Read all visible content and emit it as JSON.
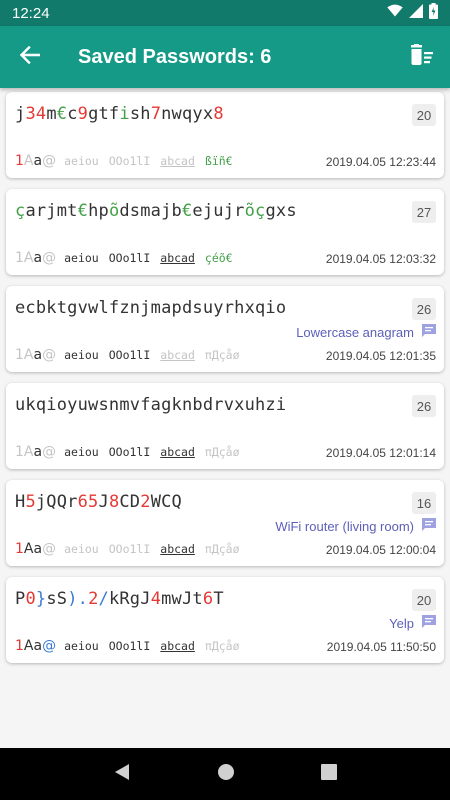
{
  "status_bar": {
    "time": "12:24",
    "icons": [
      "wifi-icon",
      "signal-icon",
      "battery-icon"
    ]
  },
  "app_bar": {
    "title": "Saved Passwords: 6"
  },
  "colors": {
    "status_bar": "#117a6b",
    "app_bar": "#159a88",
    "red": "#e53935",
    "green": "#43a047",
    "note": "#5c5fb8"
  },
  "passwords": [
    {
      "segments": [
        {
          "t": "j",
          "c": "dark"
        },
        {
          "t": "34",
          "c": "red"
        },
        {
          "t": "m",
          "c": "dark"
        },
        {
          "t": "€",
          "c": "green"
        },
        {
          "t": "c",
          "c": "dark"
        },
        {
          "t": "9",
          "c": "red"
        },
        {
          "t": "gtf",
          "c": "dark"
        },
        {
          "t": "i",
          "c": "green"
        },
        {
          "t": "sh",
          "c": "dark"
        },
        {
          "t": "7",
          "c": "red"
        },
        {
          "t": "nwqyx",
          "c": "dark"
        },
        {
          "t": "8",
          "c": "red"
        }
      ],
      "length": "20",
      "note": "",
      "date": "2019.04.05 12:23:44",
      "features": {
        "case": [
          {
            "t": "1",
            "c": "red"
          },
          {
            "t": "A",
            "c": "faint"
          },
          {
            "t": "a",
            "c": "dark"
          },
          {
            "t": "@",
            "c": "faint"
          }
        ],
        "vowels": {
          "t": "aeiou",
          "c": "faint"
        },
        "similar": {
          "t": "OOo1lI",
          "c": "faint"
        },
        "sequence": {
          "t": "abcad",
          "c": "faint"
        },
        "special": {
          "t": "ßïñ€",
          "c": "green"
        }
      }
    },
    {
      "segments": [
        {
          "t": "ç",
          "c": "green"
        },
        {
          "t": "arjmt",
          "c": "dark"
        },
        {
          "t": "€",
          "c": "green"
        },
        {
          "t": "hp",
          "c": "dark"
        },
        {
          "t": "õ",
          "c": "green"
        },
        {
          "t": "dsmajb",
          "c": "dark"
        },
        {
          "t": "€",
          "c": "green"
        },
        {
          "t": "ejujr",
          "c": "dark"
        },
        {
          "t": "õç",
          "c": "green"
        },
        {
          "t": "gxs",
          "c": "dark"
        }
      ],
      "length": "27",
      "note": "",
      "date": "2019.04.05 12:03:32",
      "features": {
        "case": [
          {
            "t": "1",
            "c": "faint"
          },
          {
            "t": "A",
            "c": "faint"
          },
          {
            "t": "a",
            "c": "dark"
          },
          {
            "t": "@",
            "c": "faint"
          }
        ],
        "vowels": {
          "t": "aeiou",
          "c": "dark"
        },
        "similar": {
          "t": "OOo1lI",
          "c": "dark"
        },
        "sequence": {
          "t": "abcad",
          "c": "dark"
        },
        "special": {
          "t": "çéõ€",
          "c": "green"
        }
      }
    },
    {
      "segments": [
        {
          "t": "ecbktgvwlfznjmapdsuyrhxqio",
          "c": "dark"
        }
      ],
      "length": "26",
      "note": "Lowercase anagram",
      "date": "2019.04.05 12:01:35",
      "features": {
        "case": [
          {
            "t": "1",
            "c": "faint"
          },
          {
            "t": "A",
            "c": "faint"
          },
          {
            "t": "a",
            "c": "dark"
          },
          {
            "t": "@",
            "c": "faint"
          }
        ],
        "vowels": {
          "t": "aeiou",
          "c": "dark"
        },
        "similar": {
          "t": "OOo1lI",
          "c": "dark"
        },
        "sequence": {
          "t": "abcad",
          "c": "faint"
        },
        "special": {
          "t": "πДçåø",
          "c": "faint"
        }
      }
    },
    {
      "segments": [
        {
          "t": "ukqioyuwsnmvfagknbdrvxuhzi",
          "c": "dark"
        }
      ],
      "length": "26",
      "note": "",
      "date": "2019.04.05 12:01:14",
      "features": {
        "case": [
          {
            "t": "1",
            "c": "faint"
          },
          {
            "t": "A",
            "c": "faint"
          },
          {
            "t": "a",
            "c": "dark"
          },
          {
            "t": "@",
            "c": "faint"
          }
        ],
        "vowels": {
          "t": "aeiou",
          "c": "dark"
        },
        "similar": {
          "t": "OOo1lI",
          "c": "dark"
        },
        "sequence": {
          "t": "abcad",
          "c": "dark"
        },
        "special": {
          "t": "πДçåø",
          "c": "faint"
        }
      }
    },
    {
      "segments": [
        {
          "t": "H",
          "c": "dark"
        },
        {
          "t": "5",
          "c": "red"
        },
        {
          "t": "jQQr",
          "c": "dark"
        },
        {
          "t": "65",
          "c": "red"
        },
        {
          "t": "J",
          "c": "dark"
        },
        {
          "t": "8",
          "c": "red"
        },
        {
          "t": "CD",
          "c": "dark"
        },
        {
          "t": "2",
          "c": "red"
        },
        {
          "t": "WCQ",
          "c": "dark"
        }
      ],
      "length": "16",
      "note": "WiFi router (living room)",
      "date": "2019.04.05 12:00:04",
      "features": {
        "case": [
          {
            "t": "1",
            "c": "red"
          },
          {
            "t": "A",
            "c": "dark"
          },
          {
            "t": "a",
            "c": "dark"
          },
          {
            "t": "@",
            "c": "faint"
          }
        ],
        "vowels": {
          "t": "aeiou",
          "c": "faint"
        },
        "similar": {
          "t": "OOo1lI",
          "c": "faint"
        },
        "sequence": {
          "t": "abcad",
          "c": "dark"
        },
        "special": {
          "t": "πДçåø",
          "c": "faint"
        }
      }
    },
    {
      "segments": [
        {
          "t": "P",
          "c": "dark"
        },
        {
          "t": "0",
          "c": "red"
        },
        {
          "t": "}",
          "c": "blue"
        },
        {
          "t": "sS",
          "c": "dark"
        },
        {
          "t": ").",
          "c": "blue"
        },
        {
          "t": "2",
          "c": "red"
        },
        {
          "t": "/",
          "c": "blue"
        },
        {
          "t": "kRgJ",
          "c": "dark"
        },
        {
          "t": "4",
          "c": "red"
        },
        {
          "t": "mwJt",
          "c": "dark"
        },
        {
          "t": "6",
          "c": "red"
        },
        {
          "t": "T",
          "c": "dark"
        }
      ],
      "length": "20",
      "note": "Yelp",
      "date": "2019.04.05 11:50:50",
      "features": {
        "case": [
          {
            "t": "1",
            "c": "red"
          },
          {
            "t": "A",
            "c": "dark"
          },
          {
            "t": "a",
            "c": "dark"
          },
          {
            "t": "@",
            "c": "blue"
          }
        ],
        "vowels": {
          "t": "aeiou",
          "c": "dark"
        },
        "similar": {
          "t": "OOo1lI",
          "c": "dark"
        },
        "sequence": {
          "t": "abcad",
          "c": "dark"
        },
        "special": {
          "t": "πДçåø",
          "c": "faint"
        }
      }
    }
  ]
}
